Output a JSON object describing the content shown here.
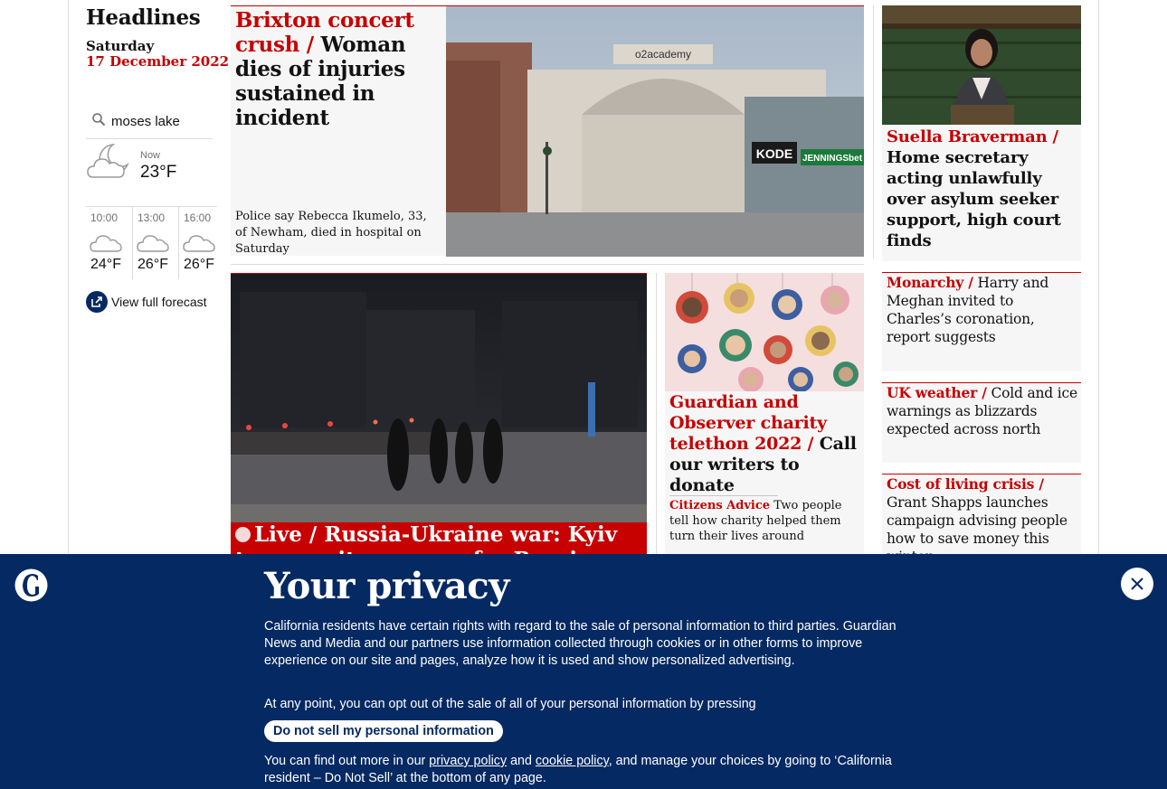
{
  "sidebar": {
    "title": "Headlines",
    "day": "Saturday",
    "date": "17 December 2022",
    "search_value": "moses lake",
    "weather_now_label": "Now",
    "weather_now_temp": "23°F",
    "forecast": [
      {
        "time": "10:00",
        "temp": "24°F",
        "icon": "cloud-icon"
      },
      {
        "time": "13:00",
        "temp": "26°F",
        "icon": "cloud-icon"
      },
      {
        "time": "16:00",
        "temp": "26°F",
        "icon": "cloud-icon"
      }
    ],
    "full_forecast_label": "View full forecast"
  },
  "stories": {
    "main": {
      "kicker": "Brixton concert crush /",
      "headline": "Woman dies of injuries sustained in incident",
      "trail": "Police say Rebecca Ikumelo, 33, of Newham, died in hospital on Saturday",
      "image_sign_1": "o2academy",
      "image_sign_2": "KODE",
      "image_sign_3": "JENNINGSbet"
    },
    "braverman": {
      "kicker": "Suella Braverman /",
      "headline": "Home secretary acting unlawfully over asylum seeker support, high court finds"
    },
    "monarchy": {
      "kicker": "Monarchy /",
      "headline": "Harry and Meghan invited to Charles’s coronation, report suggests"
    },
    "weather": {
      "kicker": "UK weather /",
      "headline": "Cold and ice warnings as blizzards expected across north"
    },
    "cost": {
      "kicker": "Cost of living crisis /",
      "headline": "Grant Shapps launches campaign advising people how to save money this winter"
    },
    "ukraine": {
      "live": "Live /",
      "headline": "Russia-Ukraine war: Kyiv tense as it prepares for Russian strikes and after"
    },
    "charity": {
      "kicker": "Guardian and Observer charity telethon 2022 /",
      "headline": "Call our writers to donate",
      "sub_kicker": "Citizens Advice",
      "sub_headline": "Two people tell how charity helped them turn their lives around"
    }
  },
  "privacy": {
    "title": "Your privacy",
    "p1": "California residents have certain rights with regard to the sale of personal information to third parties. Guardian News and Media and our partners use information collected through cookies or in other forms to improve experience on our site and pages, analyze how it is used and show personalized advertising.",
    "p2": "At any point, you can opt out of the sale of all of your personal information by pressing",
    "button": "Do not sell my personal information",
    "p3_a": "You can find out more in our ",
    "p3_link1": "privacy policy",
    "p3_and": " and ",
    "p3_link2": "cookie policy",
    "p3_b": ", and manage your choices by going to ‘California resident – Do Not Sell’ at the bottom of any page."
  },
  "colors": {
    "news_red": "#c70000",
    "brand_blue": "#052962",
    "card_bg": "#f6f6f6"
  }
}
